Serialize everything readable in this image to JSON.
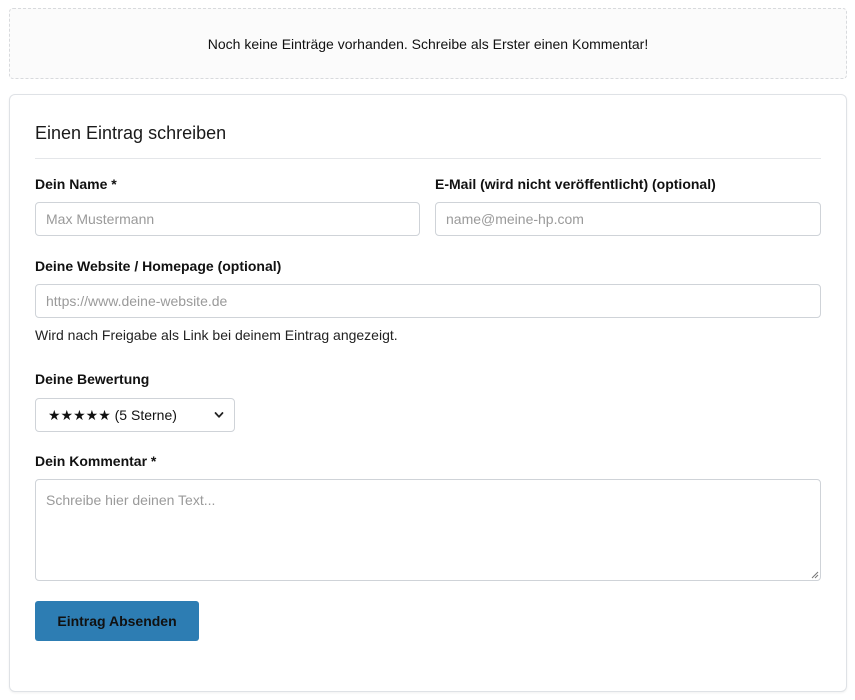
{
  "notice": {
    "text": "Noch keine Einträge vorhanden. Schreibe als Erster einen Kommentar!"
  },
  "form": {
    "title": "Einen Eintrag schreiben",
    "name": {
      "label": "Dein Name *",
      "placeholder": "Max Mustermann",
      "value": ""
    },
    "email": {
      "label": "E-Mail (wird nicht veröffentlicht) (optional)",
      "placeholder": "name@meine-hp.com",
      "value": ""
    },
    "website": {
      "label": "Deine Website / Homepage (optional)",
      "placeholder": "https://www.deine-website.de",
      "value": "",
      "hint": "Wird nach Freigabe als Link bei deinem Eintrag angezeigt."
    },
    "rating": {
      "label": "Deine Bewertung",
      "selected": "★★★★★ (5 Sterne)"
    },
    "comment": {
      "label": "Dein Kommentar *",
      "placeholder": "Schreibe hier deinen Text...",
      "value": ""
    },
    "submit_label": "Eintrag Absenden"
  },
  "colors": {
    "accent": "#2d7db3",
    "border": "#cfd3d8",
    "placeholder": "#9a9a9a"
  },
  "icons": {
    "rating_dropdown": "chevron-down-icon",
    "textarea_resize": "resize-grip-icon"
  }
}
